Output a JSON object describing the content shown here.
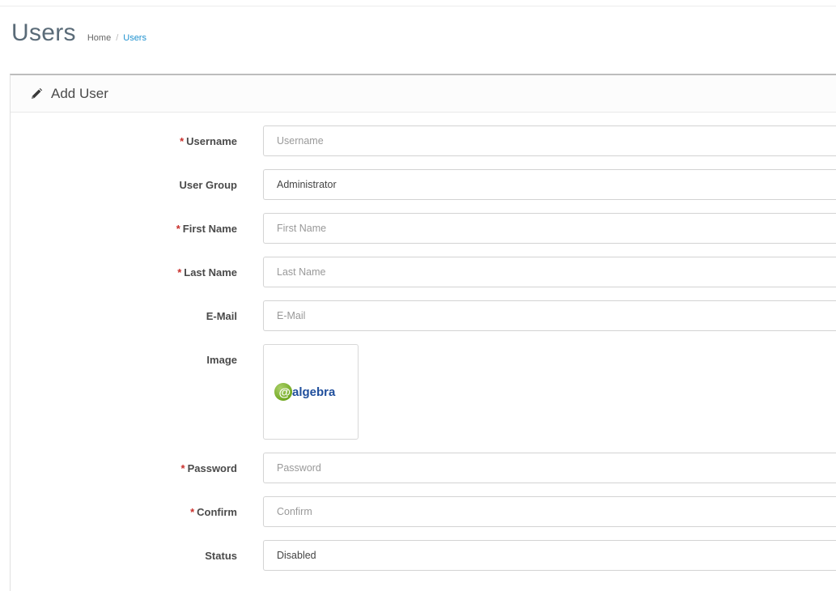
{
  "header": {
    "title": "Users",
    "breadcrumb": [
      {
        "label": "Home"
      },
      {
        "label": "Users"
      }
    ]
  },
  "panel": {
    "title": "Add User",
    "icon": "pencil-icon"
  },
  "form": {
    "username": {
      "label": "Username",
      "required": true,
      "placeholder": "Username",
      "value": ""
    },
    "user_group": {
      "label": "User Group",
      "selected": "Administrator"
    },
    "first_name": {
      "label": "First Name",
      "required": true,
      "placeholder": "First Name",
      "value": ""
    },
    "last_name": {
      "label": "Last Name",
      "required": true,
      "placeholder": "Last Name",
      "value": ""
    },
    "email": {
      "label": "E-Mail",
      "placeholder": "E-Mail",
      "value": ""
    },
    "image": {
      "label": "Image",
      "logo_text": "algebra"
    },
    "password": {
      "label": "Password",
      "required": true,
      "placeholder": "Password",
      "value": ""
    },
    "confirm": {
      "label": "Confirm",
      "required": true,
      "placeholder": "Confirm",
      "value": ""
    },
    "status": {
      "label": "Status",
      "selected": "Disabled"
    }
  },
  "colors": {
    "required": "#c9302c",
    "link": "#1e91cf",
    "logo_green": "#7cb518",
    "logo_blue": "#1f4e9c"
  }
}
